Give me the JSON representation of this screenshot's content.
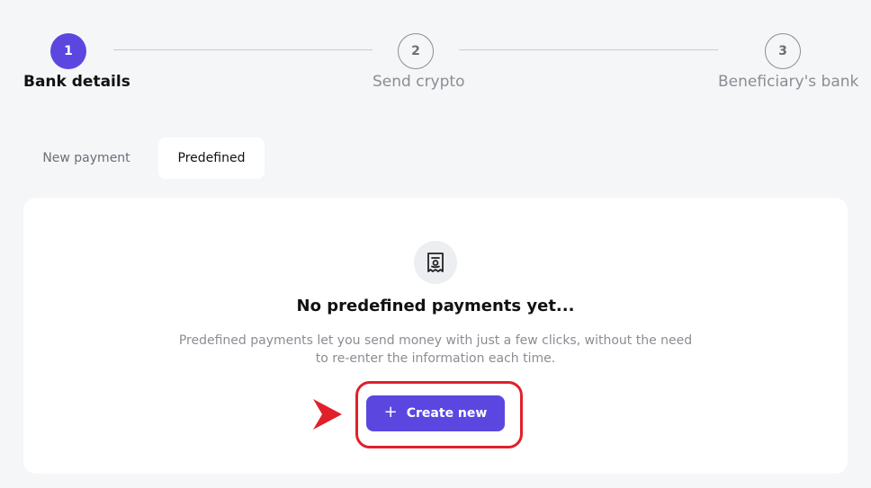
{
  "stepper": {
    "steps": [
      {
        "number": "1",
        "label": "Bank details",
        "state": "active"
      },
      {
        "number": "2",
        "label": "Send crypto",
        "state": "inactive"
      },
      {
        "number": "3",
        "label": "Beneficiary's bank",
        "state": "inactive"
      }
    ]
  },
  "tabs": [
    {
      "label": "New payment",
      "selected": false
    },
    {
      "label": "Predefined",
      "selected": true
    }
  ],
  "empty_state": {
    "icon": "receipt-icon",
    "title": "No predefined payments yet...",
    "description": "Predefined payments let you send money with just a few clicks, without the need to re-enter the information each time.",
    "button_label": "Create new",
    "button_icon": "plus-icon"
  },
  "colors": {
    "accent": "#5b47e0",
    "annotation": "#e0202a",
    "background": "#f5f6f8"
  }
}
